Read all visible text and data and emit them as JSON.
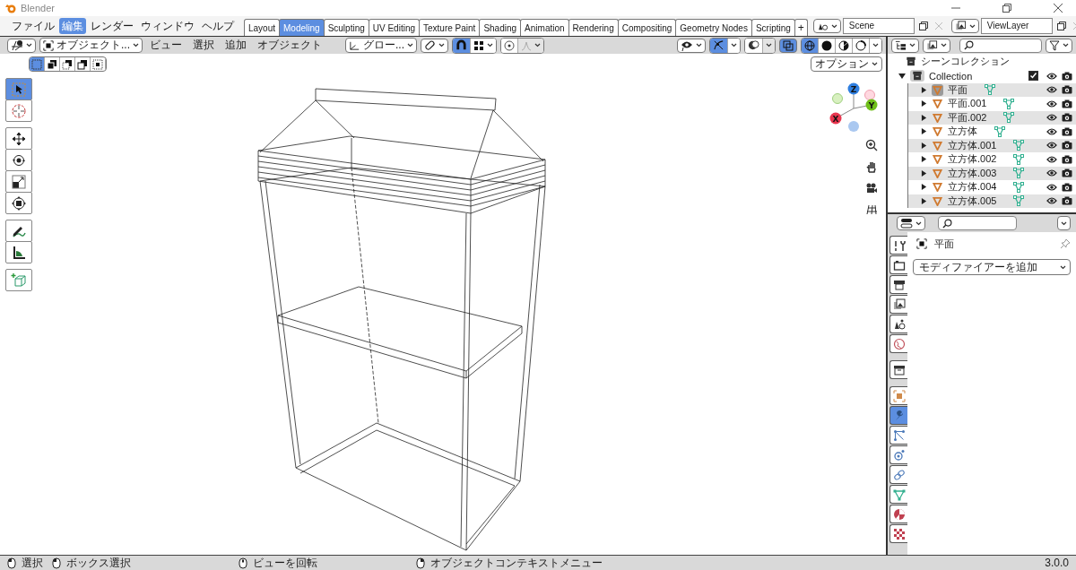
{
  "window": {
    "title": "Blender"
  },
  "menu": [
    {
      "label": "ファイル",
      "selected": false
    },
    {
      "label": "編集",
      "selected": true
    },
    {
      "label": "レンダー",
      "selected": false
    },
    {
      "label": "ウィンドウ",
      "selected": false
    },
    {
      "label": "ヘルプ",
      "selected": false
    }
  ],
  "workspaces": [
    {
      "label": "Layout",
      "selected": false
    },
    {
      "label": "Modeling",
      "selected": true
    },
    {
      "label": "Sculpting",
      "selected": false
    },
    {
      "label": "UV Editing",
      "selected": false
    },
    {
      "label": "Texture Paint",
      "selected": false
    },
    {
      "label": "Shading",
      "selected": false
    },
    {
      "label": "Animation",
      "selected": false
    },
    {
      "label": "Rendering",
      "selected": false
    },
    {
      "label": "Compositing",
      "selected": false
    },
    {
      "label": "Geometry Nodes",
      "selected": false
    },
    {
      "label": "Scripting",
      "selected": false
    }
  ],
  "add_workspace": "+",
  "scene": {
    "name": "Scene"
  },
  "view_layer": {
    "name": "ViewLayer"
  },
  "viewport": {
    "mode": "オブジェクト...",
    "menus": [
      "ビュー",
      "選択",
      "追加",
      "オブジェクト"
    ],
    "orientation": "グロー...",
    "snap_on": true,
    "gizmos_on": true,
    "xray_on": true,
    "shading": [
      {
        "kind": "wireframe",
        "selected": true
      },
      {
        "kind": "solid",
        "selected": false
      },
      {
        "kind": "material",
        "selected": false
      },
      {
        "kind": "rendered",
        "selected": false
      }
    ],
    "select_modes": [
      {
        "kind": "set",
        "selected": true
      },
      {
        "kind": "extend",
        "selected": false
      },
      {
        "kind": "subtract",
        "selected": false
      },
      {
        "kind": "invert",
        "selected": false
      },
      {
        "kind": "intersect",
        "selected": false
      }
    ],
    "options": "オプション",
    "tools": [
      {
        "kind": "select",
        "selected": true
      },
      {
        "kind": "cursor",
        "selected": false
      },
      {
        "kind": "move",
        "selected": false
      },
      {
        "kind": "rotate",
        "selected": false
      },
      {
        "kind": "scale",
        "selected": false
      },
      {
        "kind": "transform",
        "selected": false
      },
      {
        "kind": "annotate",
        "selected": false
      },
      {
        "kind": "measure",
        "selected": false
      },
      {
        "kind": "add-cube",
        "selected": false
      }
    ],
    "axes": [
      {
        "label": "Z",
        "color": "#2f7fe0"
      },
      {
        "label": "Y",
        "color": "#6fbf1a"
      },
      {
        "label": "X",
        "color": "#e8364f"
      }
    ]
  },
  "outliner": {
    "root": "シーンコレクション",
    "collection": {
      "name": "Collection",
      "expanded": true,
      "checked": true,
      "children": [
        {
          "name": "平面",
          "selected": true,
          "expanded": false
        },
        {
          "name": "平面.001",
          "selected": false,
          "expanded": false
        },
        {
          "name": "平面.002",
          "selected": false,
          "expanded": false
        },
        {
          "name": "立方体",
          "selected": false,
          "expanded": false
        },
        {
          "name": "立方体.001",
          "selected": false,
          "expanded": false
        },
        {
          "name": "立方体.002",
          "selected": false,
          "expanded": false
        },
        {
          "name": "立方体.003",
          "selected": false,
          "expanded": false
        },
        {
          "name": "立方体.004",
          "selected": false,
          "expanded": false
        },
        {
          "name": "立方体.005",
          "selected": false,
          "expanded": false
        }
      ]
    }
  },
  "properties": {
    "tabs": [
      {
        "kind": "tool",
        "selected": false
      },
      {
        "kind": "render",
        "selected": false
      },
      {
        "kind": "output",
        "selected": false
      },
      {
        "kind": "view-layer",
        "selected": false
      },
      {
        "kind": "scene",
        "selected": false
      },
      {
        "kind": "world",
        "selected": false
      },
      {
        "kind": "collection",
        "selected": false
      },
      {
        "kind": "object",
        "selected": false
      },
      {
        "kind": "modifier",
        "selected": true
      },
      {
        "kind": "particles",
        "selected": false
      },
      {
        "kind": "physics",
        "selected": false
      },
      {
        "kind": "constraints",
        "selected": false
      },
      {
        "kind": "data",
        "selected": false
      },
      {
        "kind": "material",
        "selected": false
      },
      {
        "kind": "texture",
        "selected": false
      }
    ],
    "object": "平面",
    "add_modifier": "モディファイアーを追加"
  },
  "status_bar": {
    "hints": [
      {
        "kind": "left",
        "label": "選択"
      },
      {
        "kind": "drag",
        "label": "ボックス選択"
      },
      {
        "kind": "middle",
        "label": "ビューを回転"
      },
      {
        "kind": "right",
        "label": "オブジェクトコンテキストメニュー"
      }
    ],
    "version": "3.0.0"
  }
}
